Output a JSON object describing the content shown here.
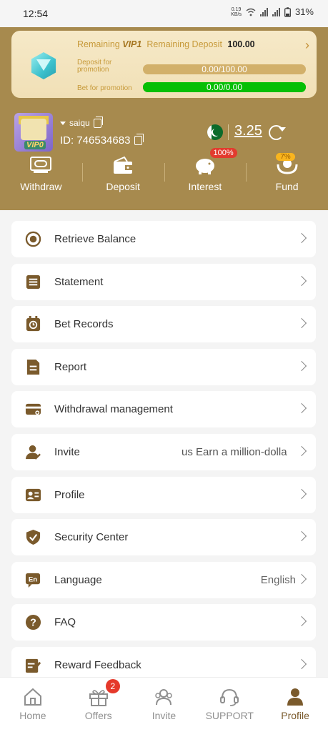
{
  "status_bar": {
    "time": "12:54",
    "net_speed_value": "0.19",
    "net_speed_unit": "KB/s",
    "battery": "31%"
  },
  "vip_card": {
    "remaining_label": "Remaining",
    "vip_level": "VIP1",
    "remaining_deposit_label": "Remaining Deposit",
    "remaining_deposit_value": "100.00",
    "deposit_label": "Deposit for promotion",
    "deposit_progress_text": "0.00/100.00",
    "deposit_progress_fraction": 0,
    "bet_label": "Bet for promotion",
    "bet_progress_text": "0.00/0.00",
    "bet_progress_fraction": 1
  },
  "user": {
    "avatar_badge": "VIP0",
    "name": "saiqu",
    "id_text": "ID: 746534683",
    "balance": "3.25"
  },
  "actions": [
    {
      "label": "Withdraw",
      "icon": "withdraw-icon"
    },
    {
      "label": "Deposit",
      "icon": "deposit-icon"
    },
    {
      "label": "Interest",
      "icon": "interest-icon",
      "badge": "100%"
    },
    {
      "label": "Fund",
      "icon": "fund-icon",
      "badge": "7%"
    }
  ],
  "menu": [
    {
      "label": "Retrieve Balance",
      "icon": "retrieve-balance-icon"
    },
    {
      "label": "Statement",
      "icon": "statement-icon"
    },
    {
      "label": "Bet Records",
      "icon": "bet-records-icon"
    },
    {
      "label": "Report",
      "icon": "report-icon"
    },
    {
      "label": "Withdrawal management",
      "icon": "withdrawal-card-icon"
    },
    {
      "label": "Invite",
      "icon": "invite-person-icon",
      "marquee": "us      Earn a million-dolla"
    },
    {
      "label": "Profile",
      "icon": "profile-card-icon"
    },
    {
      "label": "Security Center",
      "icon": "shield-check-icon"
    },
    {
      "label": "Language",
      "icon": "language-icon",
      "value": "English"
    },
    {
      "label": "FAQ",
      "icon": "faq-icon"
    },
    {
      "label": "Reward Feedback",
      "icon": "feedback-icon"
    }
  ],
  "language_icon_text": "En",
  "faq_icon_text": "?",
  "bottom_nav": [
    {
      "label": "Home",
      "icon": "home-icon"
    },
    {
      "label": "Offers",
      "icon": "gift-icon",
      "badge": "2"
    },
    {
      "label": "Invite",
      "icon": "invite-icon"
    },
    {
      "label": "SUPPORT",
      "icon": "headset-icon"
    },
    {
      "label": "Profile",
      "icon": "profile-icon",
      "active": true
    }
  ],
  "colors": {
    "brand": "#a78a4e",
    "icon": "#7a5a2c",
    "progress_green": "#06bf06",
    "badge_red": "#e23b2e"
  }
}
